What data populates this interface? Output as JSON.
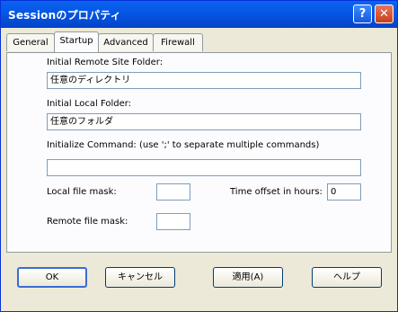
{
  "window": {
    "title": "Sessionのプロパティ",
    "help_glyph": "?",
    "close_glyph": "✕"
  },
  "tabs": [
    {
      "label": "General",
      "active": false
    },
    {
      "label": "Startup",
      "active": true
    },
    {
      "label": "Advanced",
      "active": false
    },
    {
      "label": "Firewall",
      "active": false
    }
  ],
  "startup": {
    "remote_folder_label": "Initial Remote Site Folder:",
    "remote_folder_value": "任意のディレクトリ",
    "local_folder_label": "Initial Local Folder:",
    "local_folder_value": "任意のフォルダ",
    "init_command_label": "Initialize Command: (use ';' to separate multiple commands)",
    "init_command_value": "",
    "local_mask_label": "Local file mask:",
    "local_mask_value": "",
    "time_offset_label": "Time offset in hours:",
    "time_offset_value": "0",
    "remote_mask_label": "Remote file mask:",
    "remote_mask_value": ""
  },
  "buttons": {
    "ok": "OK",
    "cancel": "キャンセル",
    "apply": "適用(A)",
    "help": "ヘルプ"
  },
  "colors": {
    "titlebar": "#0656e4",
    "close": "#c8401c",
    "face": "#ece9d8"
  }
}
